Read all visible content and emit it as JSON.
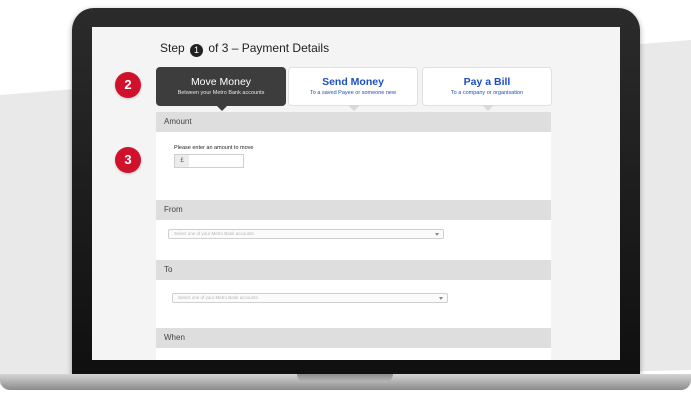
{
  "step": {
    "prefix": "Step",
    "number": "1",
    "suffix": "of 3 – Payment Details"
  },
  "tabs": [
    {
      "title": "Move Money",
      "subtitle": "Between your Metro Bank accounts",
      "active": true
    },
    {
      "title": "Send Money",
      "subtitle": "To a saved Payee or someone new",
      "active": false
    },
    {
      "title": "Pay a Bill",
      "subtitle": "To a company or organisation",
      "active": false
    }
  ],
  "amount": {
    "header": "Amount",
    "prompt": "Please enter an amount to move",
    "currency": "£",
    "value": ""
  },
  "from": {
    "header": "From",
    "placeholder": "Select one of your Metro Bank accounts"
  },
  "to": {
    "header": "To",
    "placeholder": "Select one of your Metro Bank accounts"
  },
  "when": {
    "header": "When"
  },
  "callouts": [
    "2",
    "3"
  ],
  "colors": {
    "callout": "#d0112b",
    "link_blue": "#1d4fc0",
    "active_tab": "#3d3d3d"
  }
}
